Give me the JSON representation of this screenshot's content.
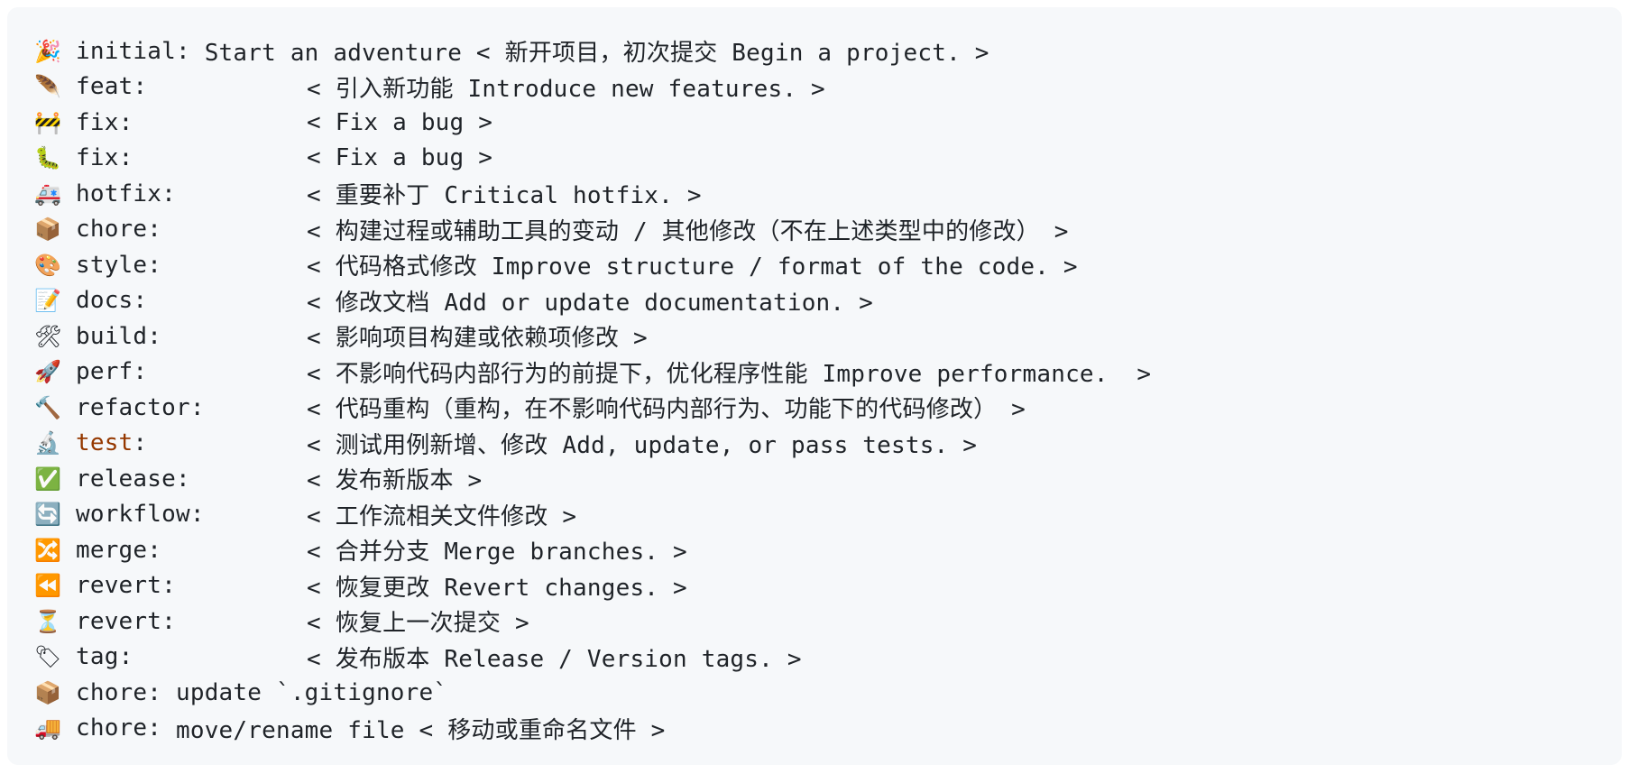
{
  "lines": [
    {
      "emoji": "🎉",
      "icon": "party-popper-icon",
      "type": "initial",
      "text": "Start an adventure < 新开项目，初次提交 Begin a project. >",
      "padded": false
    },
    {
      "emoji": "🪶",
      "icon": "feather-icon",
      "type": "feat",
      "text": "< 引入新功能 Introduce new features. >",
      "padded": true
    },
    {
      "emoji": "🚧",
      "icon": "construction-icon",
      "type": "fix",
      "text": "< Fix a bug >",
      "padded": true
    },
    {
      "emoji": "🐛",
      "icon": "bug-icon",
      "type": "fix",
      "text": "< Fix a bug >",
      "padded": true
    },
    {
      "emoji": "🚑",
      "icon": "ambulance-icon",
      "type": "hotfix",
      "text": "< 重要补丁 Critical hotfix. >",
      "padded": true
    },
    {
      "emoji": "📦",
      "icon": "package-icon",
      "type": "chore",
      "text": "< 构建过程或辅助工具的变动 / 其他修改（不在上述类型中的修改） >",
      "padded": true
    },
    {
      "emoji": "🎨",
      "icon": "palette-icon",
      "type": "style",
      "text": "< 代码格式修改 Improve structure / format of the code. >",
      "padded": true
    },
    {
      "emoji": "📝",
      "icon": "memo-icon",
      "type": "docs",
      "text": "< 修改文档 Add or update documentation. >",
      "padded": true
    },
    {
      "emoji": "🛠",
      "icon": "tools-icon",
      "type": "build",
      "text": "< 影响项目构建或依赖项修改 >",
      "padded": true
    },
    {
      "emoji": "🚀",
      "icon": "rocket-icon",
      "type": "perf",
      "text": "< 不影响代码内部行为的前提下，优化程序性能 Improve performance.  >",
      "padded": true
    },
    {
      "emoji": "🔨",
      "icon": "hammer-icon",
      "type": "refactor",
      "text": "< 代码重构（重构，在不影响代码内部行为、功能下的代码修改） >",
      "padded": true
    },
    {
      "emoji": "🔬",
      "icon": "microscope-icon",
      "type": "test",
      "text": "< 测试用例新增、修改 Add, update, or pass tests. >",
      "padded": true,
      "highlight": true
    },
    {
      "emoji": "✅",
      "icon": "check-mark-icon",
      "type": "release",
      "text": "< 发布新版本 >",
      "padded": true
    },
    {
      "emoji": "🔄",
      "icon": "cycle-arrows-icon",
      "type": "workflow",
      "text": "< 工作流相关文件修改 >",
      "padded": true
    },
    {
      "emoji": "🔀",
      "icon": "shuffle-icon",
      "type": "merge",
      "text": "< 合并分支 Merge branches. >",
      "padded": true
    },
    {
      "emoji": "⏪",
      "icon": "rewind-icon",
      "type": "revert",
      "text": "< 恢复更改 Revert changes. >",
      "padded": true
    },
    {
      "emoji": "⏳",
      "icon": "hourglass-icon",
      "type": "revert",
      "text": "< 恢复上一次提交 >",
      "padded": true
    },
    {
      "emoji": "🏷",
      "icon": "label-tag-icon",
      "type": "tag",
      "text": "< 发布版本 Release / Version tags. >",
      "padded": true
    },
    {
      "emoji": "📦",
      "icon": "package-icon",
      "type": "chore",
      "text": "update `.gitignore`",
      "padded": false
    },
    {
      "emoji": "🚚",
      "icon": "truck-icon",
      "type": "chore",
      "text": "move/rename file < 移动或重命名文件 >",
      "padded": false
    }
  ],
  "colors": {
    "background": "#f6f8fa",
    "text": "#1f2328",
    "keyword": "#953800"
  }
}
